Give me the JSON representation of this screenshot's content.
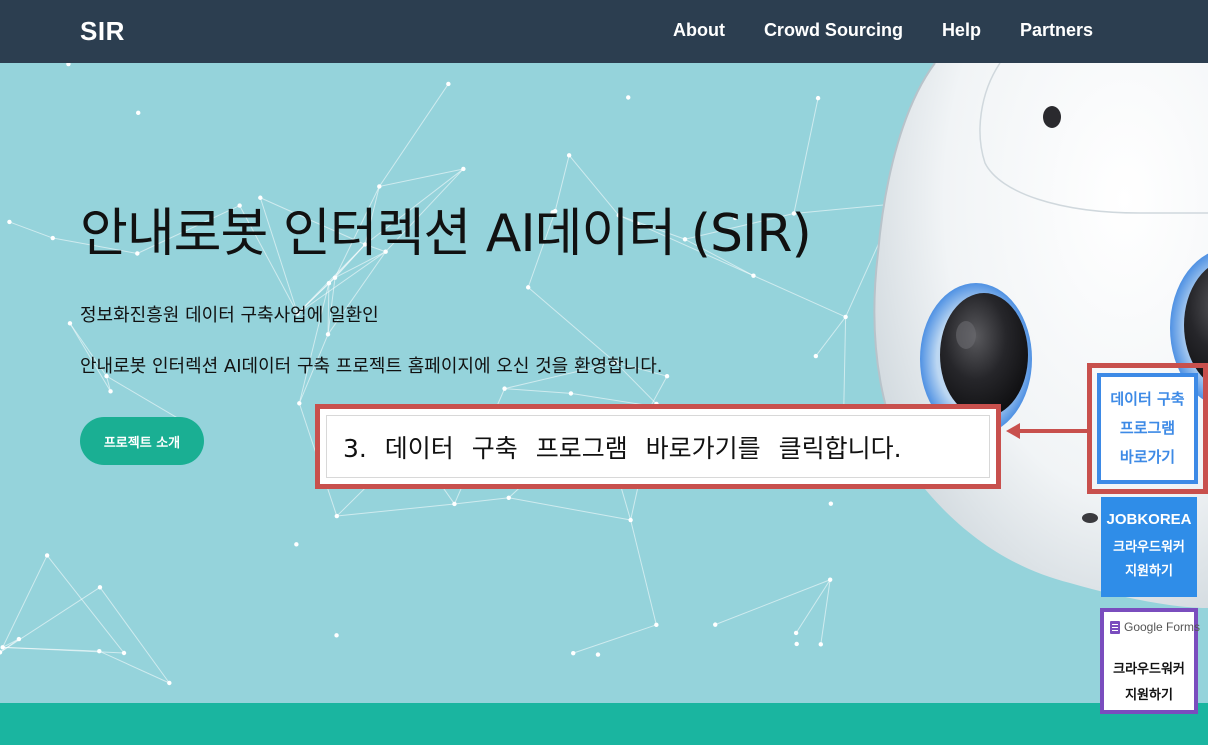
{
  "navbar": {
    "brand": "SIR",
    "links": [
      "About",
      "Crowd Sourcing",
      "Help",
      "Partners"
    ]
  },
  "hero": {
    "title": "안내로봇 인터렉션 AI데이터 (SIR)",
    "line1": "정보화진흥원 데이터 구축사업에 일환인",
    "line2": "안내로봇 인터렉션 AI데이터 구축 프로젝트 홈페이지에 오신 것을 환영합니다.",
    "button_label": "프로젝트 소개"
  },
  "callout": {
    "text": "3. 데이터 구축 프로그램 바로가기를 클릭합니다."
  },
  "side_buttons": {
    "data_program": [
      "데이터 구축",
      "프로그램",
      "바로가기"
    ],
    "jobkorea": {
      "brand": "JOBKOREA",
      "lines": [
        "크라우드워커",
        "지원하기"
      ]
    },
    "google_forms": {
      "brand": "Google Forms",
      "lines": [
        "크라우드워커",
        "지원하기"
      ]
    }
  },
  "colors": {
    "navbar": "#2c3e50",
    "hero_bg": "#95d3db",
    "accent_green": "#1aaf93",
    "callout_border": "#c8504d",
    "jobkorea_blue": "#2f8de8",
    "forms_purple": "#7a4dbe"
  }
}
